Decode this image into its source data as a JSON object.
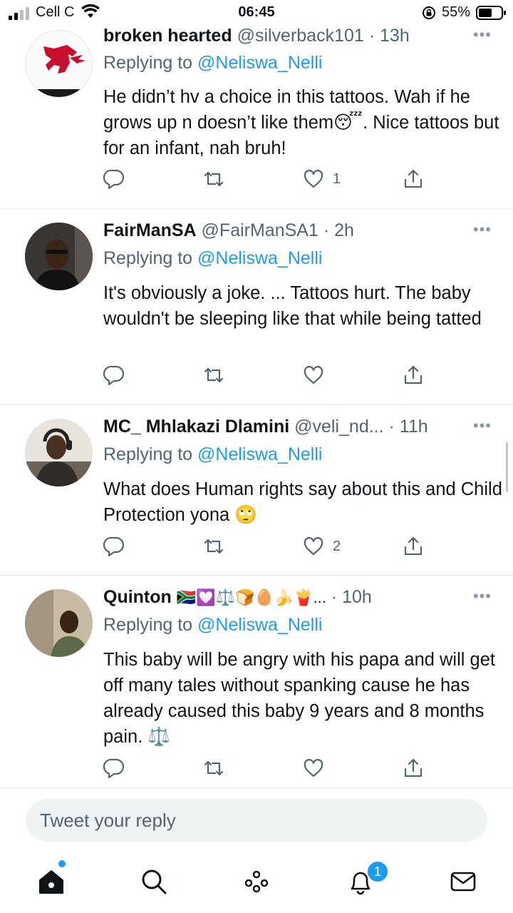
{
  "status_bar": {
    "carrier": "Cell C",
    "time": "06:45",
    "battery": "55%"
  },
  "tweets": [
    {
      "name": "broken hearted",
      "handle": "@silverback101",
      "time": "13h",
      "replying_prefix": "Replying to ",
      "replying_to": "@Neliswa_Nelli",
      "body": "He didn’t hv a choice in this tattoos. Wah if he grows up n doesn’t like them😴. Nice tattoos but for an infant, nah bruh!",
      "likes": "1"
    },
    {
      "name": "FairManSA",
      "handle": "@FairManSA1",
      "time": "2h",
      "replying_prefix": "Replying to ",
      "replying_to": "@Neliswa_Nelli",
      "body": "It's obviously a joke. ... Tattoos hurt. The baby wouldn't be sleeping like that while being tatted",
      "likes": ""
    },
    {
      "name": "MC_ Mhlakazi Dlamini",
      "handle": "@veli_nd...",
      "time": "11h",
      "replying_prefix": "Replying to ",
      "replying_to": "@Neliswa_Nelli",
      "body": "What does Human rights say about this and Child Protection yona 🙄",
      "likes": "2"
    },
    {
      "name": "Quinton",
      "name_emojis": "🇿🇦💟⚖️🍞🥚🍌🍟...",
      "handle": "",
      "time": "10h",
      "replying_prefix": "Replying to ",
      "replying_to": "@Neliswa_Nelli",
      "body": "This baby will be angry with his papa and will get off many tales without spanking cause he has already caused this baby 9 years and 8 months pain. ⚖️",
      "likes": ""
    }
  ],
  "more_glyph": "•••",
  "time_sep": " · ",
  "reply_box": {
    "placeholder": "Tweet your reply"
  },
  "tab_bar": {
    "notifications_badge": "1"
  },
  "icons": {
    "reply": "comment-icon",
    "retweet": "retweet-icon",
    "like": "heart-icon",
    "share": "share-icon"
  },
  "colors": {
    "accent": "#1d9bf0",
    "muted": "#536471",
    "divider": "#e4e8eb"
  }
}
